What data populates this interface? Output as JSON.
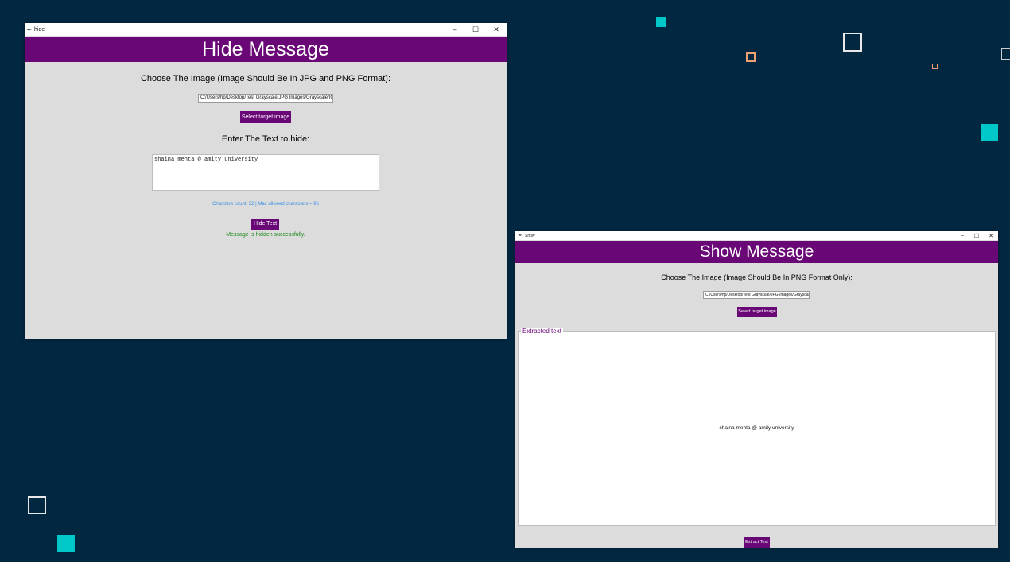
{
  "hide_window": {
    "title": "hide",
    "controls": {
      "minimize": "–",
      "maximize": "☐",
      "close": "✕"
    },
    "banner": "Hide Message",
    "choose_label": "Choose The Image (Image Should Be In JPG and PNG Format):",
    "path_value": "C:/Users/hp/Desktop/Test Grayscale/JPG Images/Grayscale/IG.j",
    "select_button": "Select target image",
    "enter_label": "Enter The Text to hide:",
    "text_value": "shaina mehta @ amity university",
    "char_count": "Charcters count: 32 | Max allowed characters = 96",
    "hide_button": "Hide Text",
    "status": "Message is hidden successfully."
  },
  "show_window": {
    "title": "Show",
    "controls": {
      "minimize": "–",
      "maximize": "☐",
      "close": "✕"
    },
    "banner": "Show Message",
    "choose_label": "Choose The Image (Image Should Be In PNG Format Only):",
    "path_value": "C:/Users/hp/Desktop/Test Grayscale/JPG Images/Grayscale/ew",
    "select_button": "Select target image",
    "extracted_legend": "Extracted text",
    "extracted_value": "shaina mehta @ amity university",
    "extract_button": "Extract Text"
  },
  "colors": {
    "desktop": "#022740",
    "banner": "#6a0777",
    "button": "#6a0777",
    "count_text": "#3a8ee6",
    "success_text": "#1f8a1f",
    "accent_cyan": "#00c8c8",
    "accent_orange": "#f0a070"
  }
}
